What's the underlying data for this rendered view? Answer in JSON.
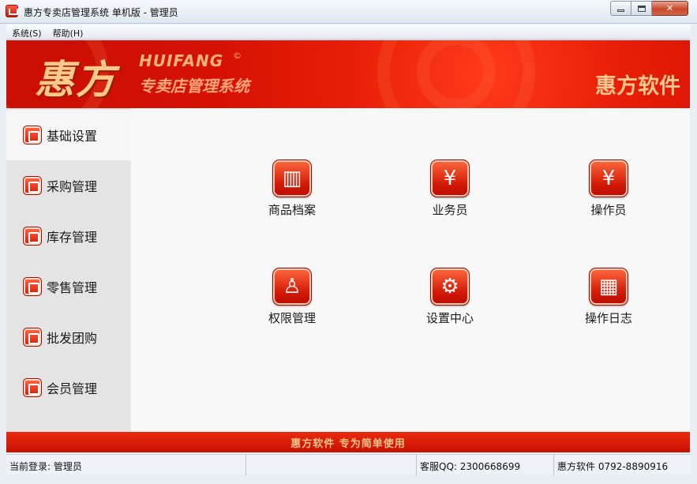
{
  "window": {
    "title": "惠方专卖店管理系统 单机版 - 管理员",
    "min_glyph": "",
    "max_glyph": "",
    "close_glyph": "✕"
  },
  "menu": {
    "items": [
      {
        "label": "系统(S)"
      },
      {
        "label": "帮助(H)"
      }
    ]
  },
  "banner": {
    "brand_cn": "惠方",
    "brand_en": "HUIFANG",
    "brand_mark": "©",
    "brand_subtitle": "专卖店管理系统",
    "brand_right": "惠方软件"
  },
  "sidebar": {
    "items": [
      {
        "label": "基础设置",
        "icon": "settings-list-icon"
      },
      {
        "label": "采购管理",
        "icon": "shopping-bag-icon"
      },
      {
        "label": "库存管理",
        "icon": "warehouse-icon"
      },
      {
        "label": "零售管理",
        "icon": "retail-chart-icon"
      },
      {
        "label": "批发团购",
        "icon": "wholesale-chart-icon"
      },
      {
        "label": "会员管理",
        "icon": "member-card-icon"
      }
    ]
  },
  "tiles": [
    {
      "label": "商品档案",
      "icon": "books-icon",
      "glyph": "▥"
    },
    {
      "label": "业务员",
      "icon": "salesperson-icon",
      "glyph": "¥"
    },
    {
      "label": "操作员",
      "icon": "operator-icon",
      "glyph": "¥"
    },
    {
      "label": "权限管理",
      "icon": "org-chart-icon",
      "glyph": "♙"
    },
    {
      "label": "设置中心",
      "icon": "gears-icon",
      "glyph": "⚙"
    },
    {
      "label": "操作日志",
      "icon": "log-table-icon",
      "glyph": "▦"
    }
  ],
  "footer": {
    "slogan": "惠方软件  专为简单使用"
  },
  "status": {
    "login": "当前登录: 管理员",
    "qq": "客服QQ: 2300668699",
    "phone": "惠方软件 0792-8890916"
  },
  "colors": {
    "accent": "#d61204",
    "gold": "#f8c78f"
  }
}
